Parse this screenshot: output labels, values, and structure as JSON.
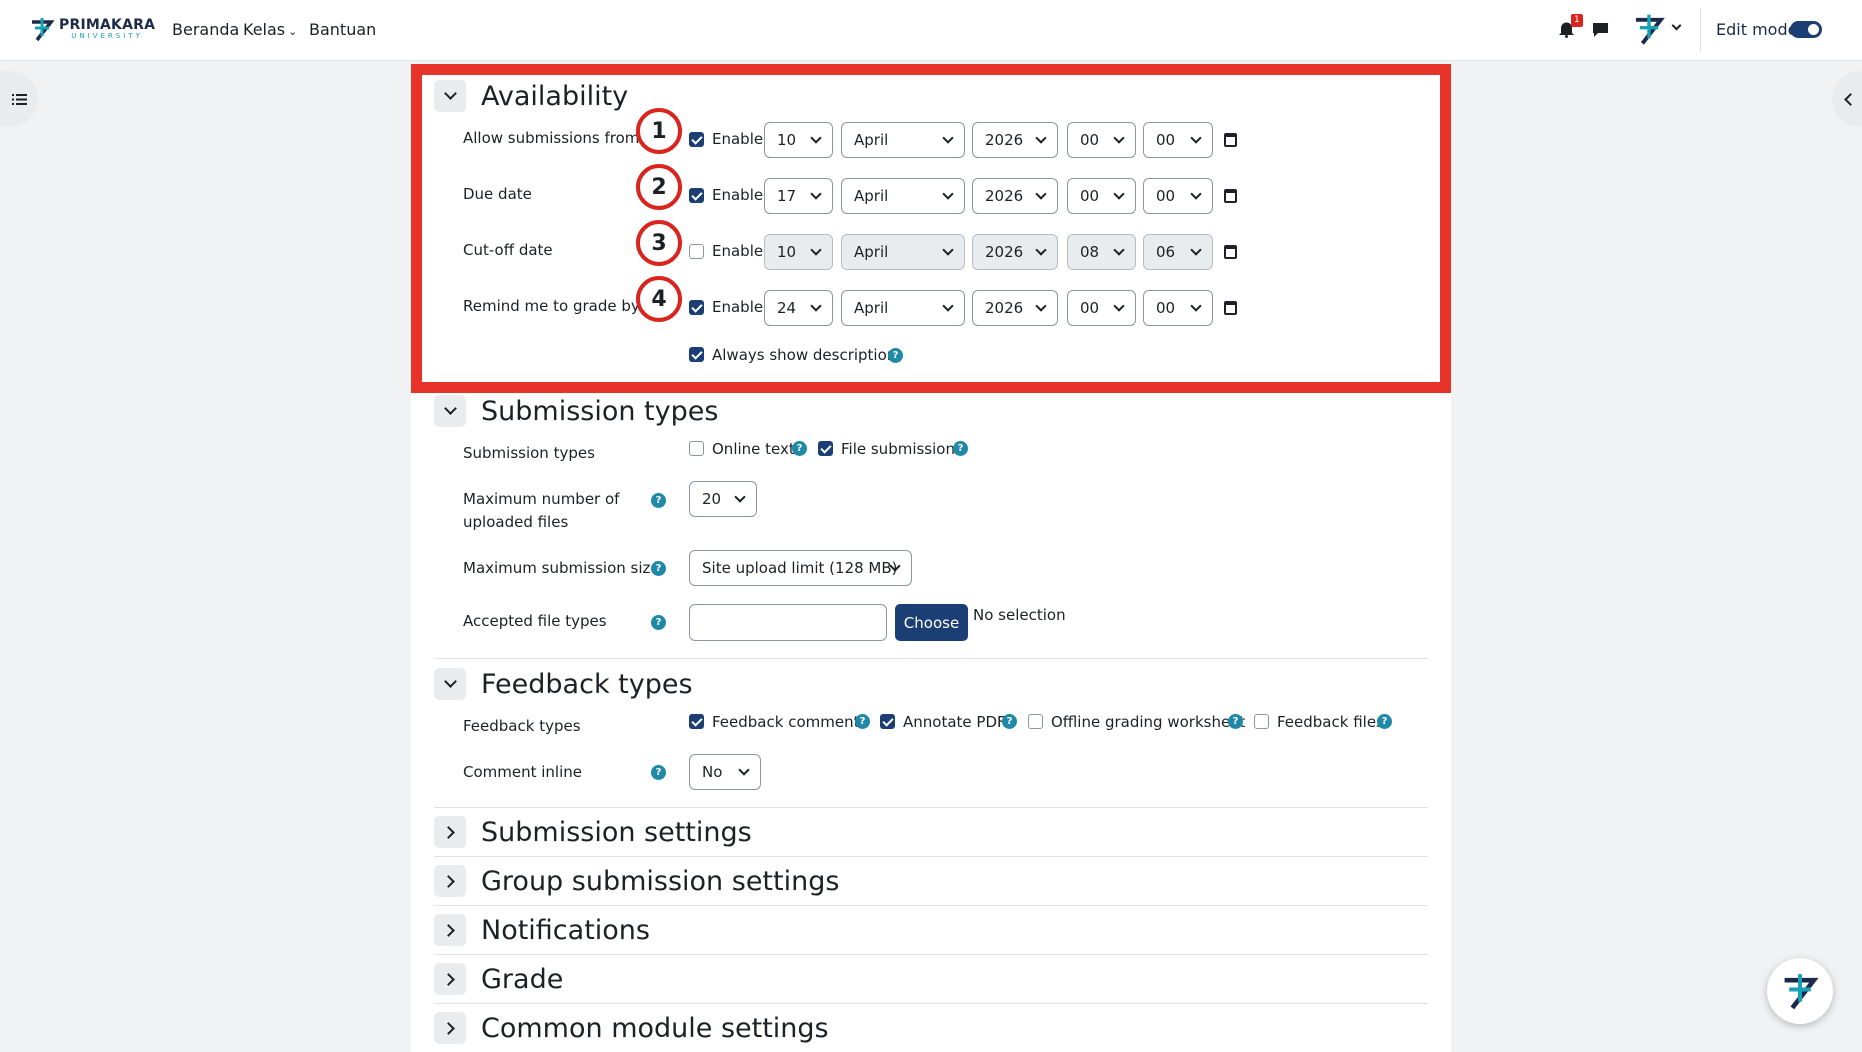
{
  "header": {
    "logo_line1": "PRIMAKARA",
    "logo_line2": "UNIVERSITY",
    "nav": [
      "Beranda",
      "Kelas",
      "Bantuan"
    ],
    "notification_count": "1",
    "edit_mode_label": "Edit mode",
    "edit_mode_on": true
  },
  "availability": {
    "title": "Availability",
    "rows": [
      {
        "label": "Allow submissions from",
        "marker": "1",
        "enabled": true,
        "enable_label": "Enable",
        "day": "10",
        "month": "April",
        "year": "2026",
        "hour": "00",
        "minute": "00"
      },
      {
        "label": "Due date",
        "marker": "2",
        "enabled": true,
        "enable_label": "Enable",
        "day": "17",
        "month": "April",
        "year": "2026",
        "hour": "00",
        "minute": "00"
      },
      {
        "label": "Cut-off date",
        "marker": "3",
        "enabled": false,
        "enable_label": "Enable",
        "day": "10",
        "month": "April",
        "year": "2026",
        "hour": "08",
        "minute": "06"
      },
      {
        "label": "Remind me to grade by",
        "marker": "4",
        "enabled": true,
        "enable_label": "Enable",
        "day": "24",
        "month": "April",
        "year": "2026",
        "hour": "00",
        "minute": "00"
      }
    ],
    "always_show_label": "Always show description",
    "always_show_checked": true
  },
  "submission_types": {
    "title": "Submission types",
    "types_label": "Submission types",
    "online_text": "Online text",
    "online_text_checked": false,
    "file_submissions": "File submissions",
    "file_submissions_checked": true,
    "max_files_label_1": "Maximum number of",
    "max_files_label_2": "uploaded files",
    "max_files_value": "20",
    "max_size_label": "Maximum submission size",
    "max_size_value": "Site upload limit (128 MB)",
    "accepted_label": "Accepted file types",
    "choose_label": "Choose",
    "no_selection": "No selection"
  },
  "feedback_types": {
    "title": "Feedback types",
    "types_label": "Feedback types",
    "options": [
      {
        "label": "Feedback comments",
        "checked": true
      },
      {
        "label": "Annotate PDF",
        "checked": true
      },
      {
        "label": "Offline grading worksheet",
        "checked": false
      },
      {
        "label": "Feedback files",
        "checked": false
      }
    ],
    "comment_inline_label": "Comment inline",
    "comment_inline_value": "No"
  },
  "collapsed_sections": [
    "Submission settings",
    "Group submission settings",
    "Notifications",
    "Grade",
    "Common module settings"
  ],
  "colors": {
    "highlight": "#e8332a",
    "primary": "#1b3f75",
    "help": "#1f8aa8"
  }
}
